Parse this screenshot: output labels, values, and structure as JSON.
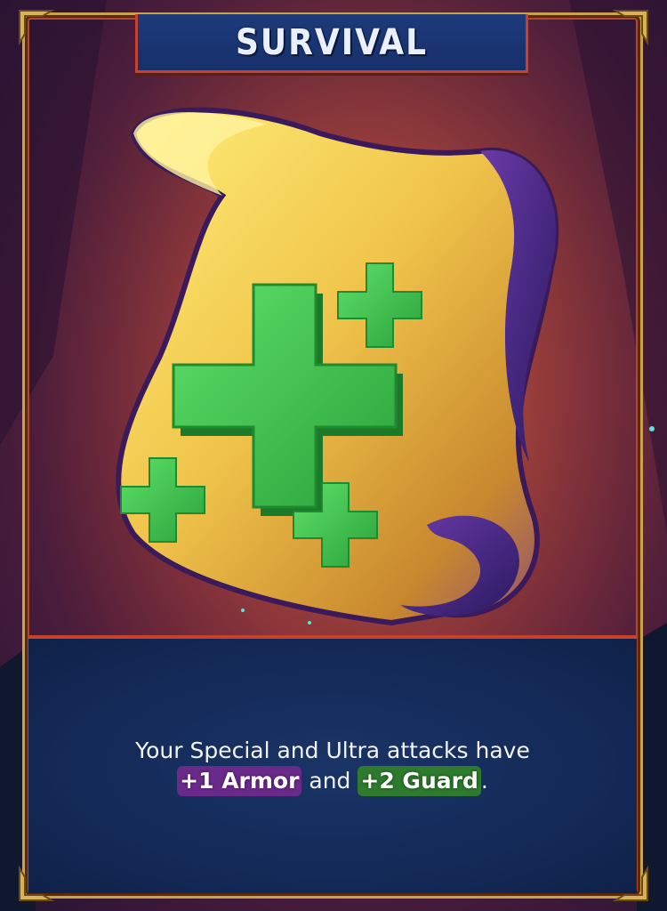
{
  "card": {
    "title": "SURVIVAL",
    "description_line1": "Your Special and Ultra attacks have",
    "keyword_armor": "+1 Armor",
    "conjunction": "and",
    "keyword_guard": "+2 Guard",
    "end_punct": "."
  },
  "colors": {
    "banner": "#1d3a7a",
    "frame_gold": "#c9a24a",
    "frame_red": "#c8412c",
    "panel": "#142a58",
    "scroll": "#f2d25a",
    "cross_green": "#3fc24a",
    "armor_purple": "#6a2a8a",
    "guard_green": "#2e7a2e"
  },
  "icons": [
    "scroll-icon",
    "plus-icon"
  ]
}
